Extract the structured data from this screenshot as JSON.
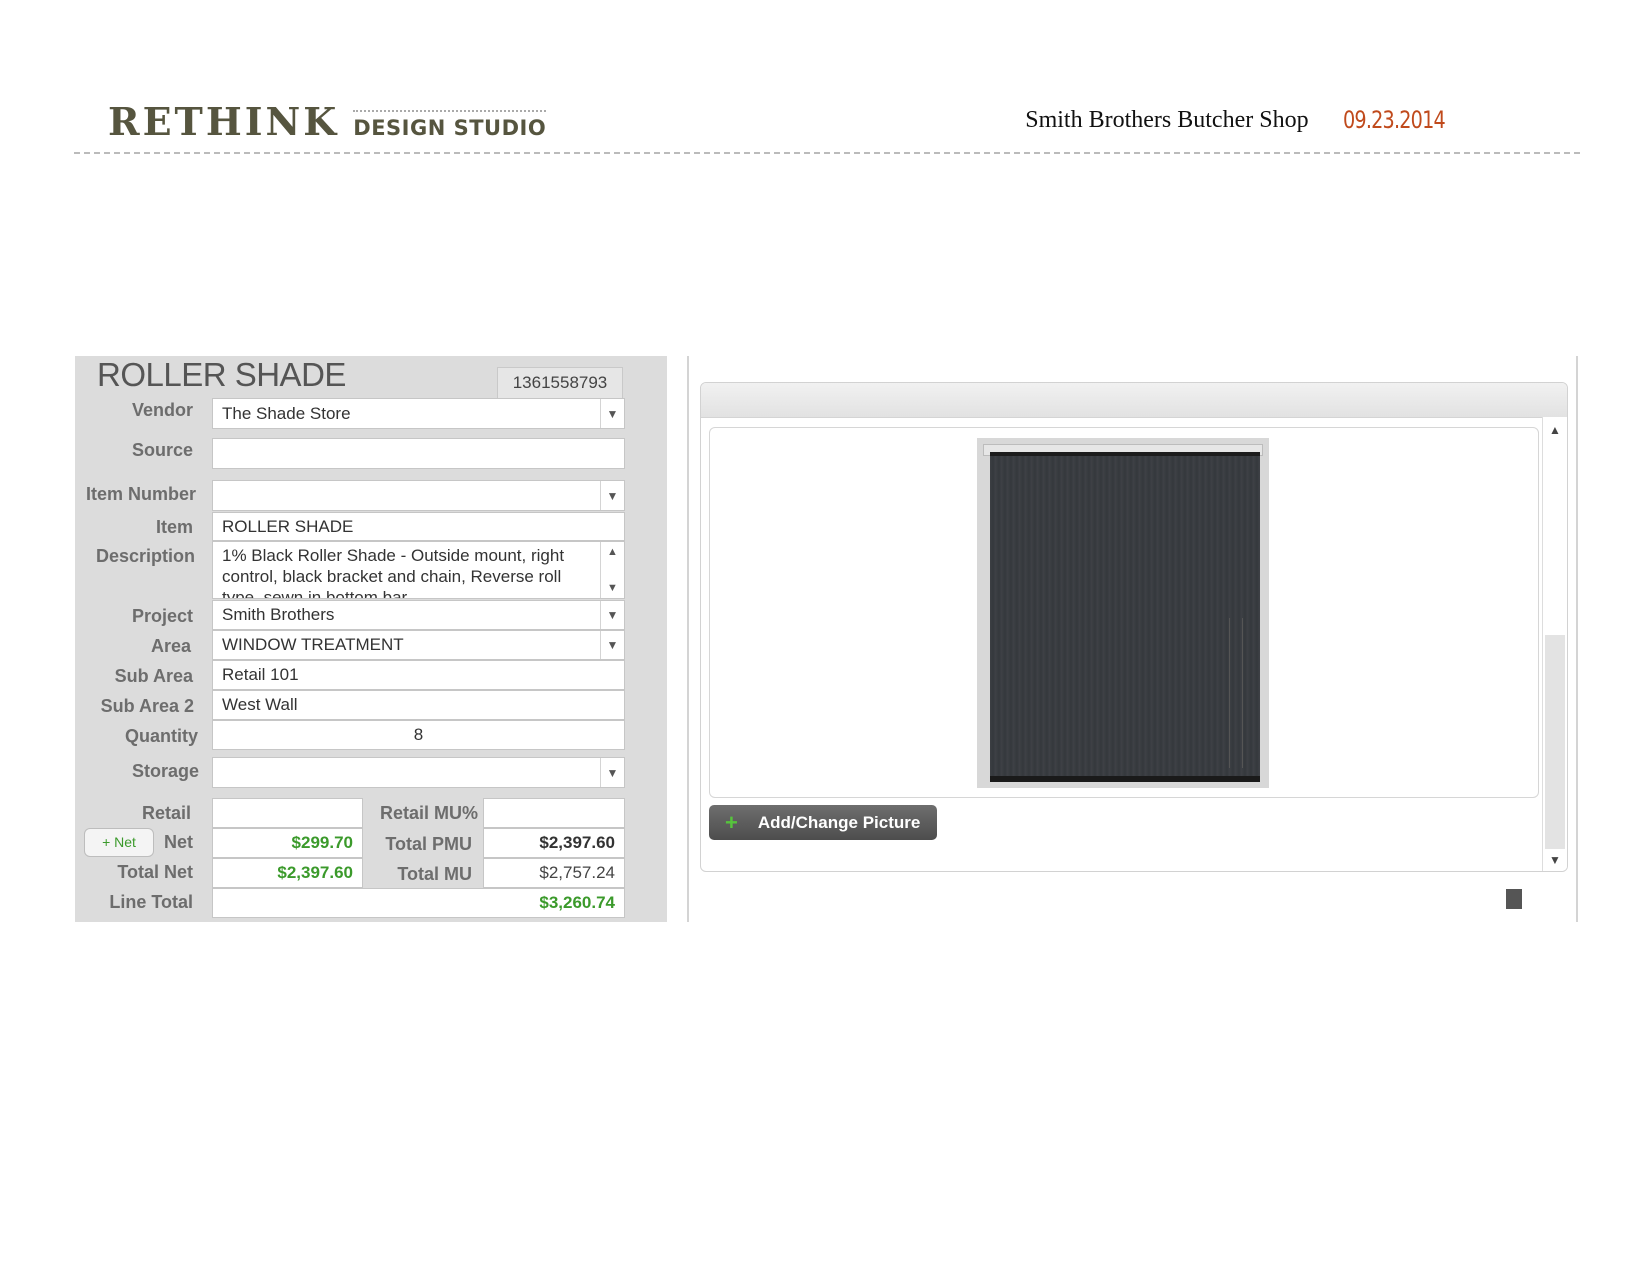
{
  "header": {
    "brand_main": "RETHINK",
    "brand_sub": "DESIGN STUDIO",
    "client": "Smith Brothers Butcher Shop",
    "date": "09.23.2014"
  },
  "form": {
    "title": "ROLLER SHADE",
    "record_id": "1361558793",
    "labels": {
      "vendor": "Vendor",
      "source": "Source",
      "item_number": "Item Number",
      "item": "Item",
      "description": "Description",
      "project": "Project",
      "area": "Area",
      "sub_area": "Sub Area",
      "sub_area_2": "Sub Area 2",
      "quantity": "Quantity",
      "storage": "Storage",
      "retail": "Retail",
      "net": "Net",
      "total_net": "Total Net",
      "line_total": "Line Total",
      "retail_mu_pct": "Retail MU%",
      "total_pmu": "Total PMU",
      "total_mu": "Total MU"
    },
    "values": {
      "vendor": "The Shade Store",
      "source": "",
      "item_number": "",
      "item": "ROLLER SHADE",
      "description": "1% Black Roller Shade - Outside mount, right control, black bracket and chain, Reverse roll type, sewn in bottom bar",
      "project": "Smith Brothers",
      "area": "WINDOW TREATMENT",
      "sub_area": "Retail 101",
      "sub_area_2": "West Wall",
      "quantity": "8",
      "storage": "",
      "retail": "",
      "net": "$299.70",
      "total_net": "$2,397.60",
      "line_total": "$3,260.74",
      "retail_mu_pct": "",
      "total_pmu": "$2,397.60",
      "total_mu": "$2,757.24"
    },
    "net_button": "+ Net",
    "dropdown_glyph": "▼",
    "scroll_up_glyph": "▲",
    "scroll_down_glyph": "▼"
  },
  "picture_panel": {
    "add_button_label": "Add/Change Picture",
    "add_button_icon": "+",
    "photo_subject": "black roller shade",
    "scroll_up_glyph": "▲",
    "scroll_down_glyph": "▼"
  },
  "colors": {
    "brand": "#56553f",
    "date": "#c04a1c",
    "money_green": "#3b9a2b",
    "panel_gray": "#dcdcdc"
  }
}
